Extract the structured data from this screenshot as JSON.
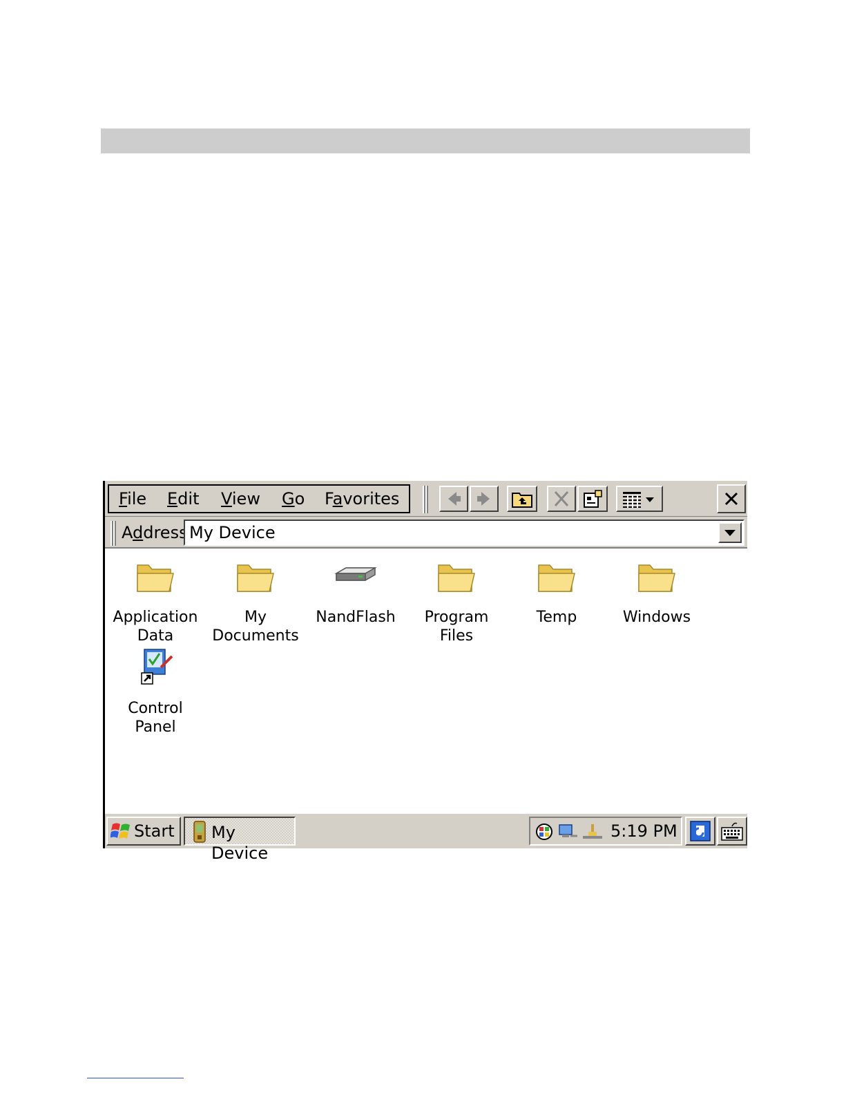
{
  "menu": {
    "file": {
      "u": "F",
      "rest": "ile"
    },
    "edit": {
      "u": "E",
      "rest": "dit"
    },
    "view": {
      "u": "V",
      "rest": "iew"
    },
    "go": {
      "u": "G",
      "rest": "o"
    },
    "favorites": {
      "pre": "F",
      "u": "a",
      "rest": "vorites"
    }
  },
  "address": {
    "label_pre": "A",
    "label_u": "d",
    "label_rest": "dress",
    "value": "My Device"
  },
  "items": [
    {
      "label": "Application\nData",
      "icon": "folder-icon"
    },
    {
      "label": "My\nDocuments",
      "icon": "folder-icon"
    },
    {
      "label": "NandFlash",
      "icon": "drive-icon"
    },
    {
      "label": "Program Files",
      "icon": "folder-icon"
    },
    {
      "label": "Temp",
      "icon": "folder-icon"
    },
    {
      "label": "Windows",
      "icon": "folder-icon"
    },
    {
      "label": "Control\nPanel",
      "icon": "control-panel-shortcut-icon"
    }
  ],
  "taskbar": {
    "start_label": "Start",
    "task_label": "My Device",
    "clock": "5:19 PM"
  },
  "colors": {
    "chrome": "#d4d0c8",
    "folder": "#f5d97a",
    "accent": "#0a246a"
  }
}
